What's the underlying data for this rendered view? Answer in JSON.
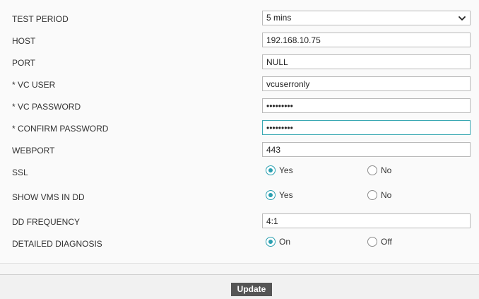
{
  "form": {
    "test_period": {
      "label": "TEST PERIOD",
      "value": "5 mins",
      "icon": "chevron-down-icon"
    },
    "host": {
      "label": "HOST",
      "value": "192.168.10.75"
    },
    "port": {
      "label": "PORT",
      "value": "NULL"
    },
    "vc_user": {
      "label": "* VC USER",
      "value": "vcuserronly"
    },
    "vc_password": {
      "label": "* VC PASSWORD",
      "value": "•••••••••"
    },
    "confirm_password": {
      "label": "* CONFIRM PASSWORD",
      "value": "•••••••••"
    },
    "webport": {
      "label": "WEBPORT",
      "value": "443"
    },
    "ssl": {
      "label": "SSL",
      "options": [
        "Yes",
        "No"
      ],
      "selected": "Yes"
    },
    "show_vms_in_dd": {
      "label": "SHOW VMS IN DD",
      "options": [
        "Yes",
        "No"
      ],
      "selected": "Yes"
    },
    "dd_frequency": {
      "label": "DD FREQUENCY",
      "value": "4:1"
    },
    "detailed_diagnosis": {
      "label": "DETAILED DIAGNOSIS",
      "options": [
        "On",
        "Off"
      ],
      "selected": "On"
    }
  },
  "footer": {
    "update_label": "Update"
  },
  "colors": {
    "accent": "#2a9fb0",
    "focus_border": "#3aa8b3",
    "button_bg": "#555555"
  }
}
